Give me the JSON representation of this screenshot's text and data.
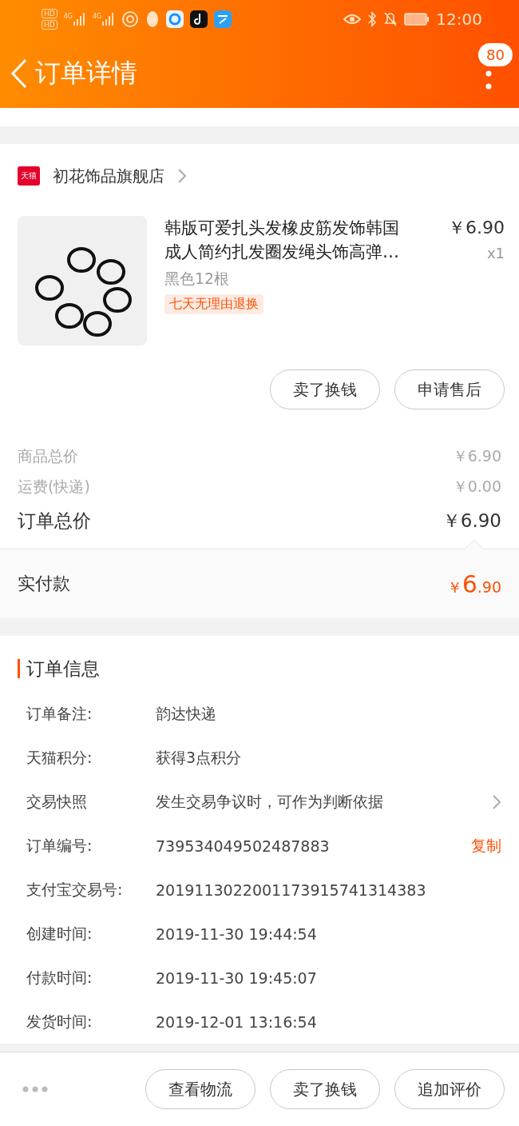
{
  "status_bar": {
    "sim_labels": [
      "HD",
      "HD"
    ],
    "network_labels": [
      "4G",
      "4G"
    ],
    "time": "12:00"
  },
  "header": {
    "title": "订单详情",
    "badge": "80"
  },
  "store": {
    "badge": "天猫",
    "name": "初花饰品旗舰店"
  },
  "item": {
    "title": "韩版可爱扎头发橡皮筋发饰韩国成人简约扎发圈发绳头饰高弹…",
    "spec": "黑色12根",
    "tag": "七天无理由退换",
    "price": "￥6.90",
    "quantity": "x1"
  },
  "item_actions": [
    "卖了换钱",
    "申请售后"
  ],
  "summary": [
    {
      "label": "商品总价",
      "value": "￥6.90",
      "kind": "minor"
    },
    {
      "label": "运费(快递)",
      "value": "￥0.00",
      "kind": "minor"
    },
    {
      "label": "订单总价",
      "value": "￥6.90",
      "kind": "major"
    }
  ],
  "paid": {
    "label": "实付款",
    "currency": "￥",
    "integer": "6",
    "decimal": ".90"
  },
  "order_info": {
    "title": "订单信息",
    "rows": [
      {
        "label": "订单备注:",
        "value": "韵达快递",
        "kind": "plain"
      },
      {
        "label": "天猫积分:",
        "value": "获得3点积分",
        "kind": "plain"
      },
      {
        "label": "交易快照",
        "value": "发生交易争议时，可作为判断依据",
        "kind": "link"
      },
      {
        "label": "订单编号:",
        "value": "739534049502487883",
        "kind": "copy",
        "action": "复制"
      },
      {
        "label": "支付宝交易号:",
        "value": "2019113022001173915741314383",
        "kind": "plain"
      },
      {
        "label": "创建时间:",
        "value": "2019-11-30 19:44:54",
        "kind": "plain"
      },
      {
        "label": "付款时间:",
        "value": "2019-11-30 19:45:07",
        "kind": "plain"
      },
      {
        "label": "发货时间:",
        "value": "2019-12-01 13:16:54",
        "kind": "plain"
      }
    ]
  },
  "bottom_bar": {
    "buttons": [
      "查看物流",
      "卖了换钱",
      "追加评价"
    ]
  }
}
